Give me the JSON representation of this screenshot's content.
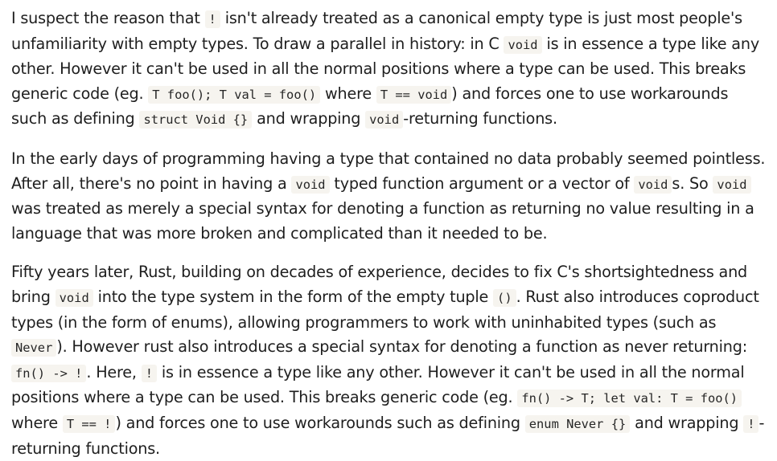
{
  "paragraphs": [
    {
      "segments": [
        {
          "t": "text",
          "v": "I suspect the reason that "
        },
        {
          "t": "code",
          "v": "!"
        },
        {
          "t": "text",
          "v": " isn't already treated as a canonical empty type is just most people's unfamiliarity with empty types. To draw a parallel in history: in C "
        },
        {
          "t": "code",
          "v": "void"
        },
        {
          "t": "text",
          "v": " is in essence a type like any other. However it can't be used in all the normal positions where a type can be used. This breaks generic code (eg. "
        },
        {
          "t": "code",
          "v": "T foo(); T val = foo()"
        },
        {
          "t": "text",
          "v": " where "
        },
        {
          "t": "code",
          "v": "T == void"
        },
        {
          "t": "text",
          "v": ") and forces one to use workarounds such as defining "
        },
        {
          "t": "code",
          "v": "struct Void {}"
        },
        {
          "t": "text",
          "v": " and wrapping "
        },
        {
          "t": "code",
          "v": "void"
        },
        {
          "t": "text",
          "v": "-returning functions."
        }
      ]
    },
    {
      "segments": [
        {
          "t": "text",
          "v": "In the early days of programming having a type that contained no data probably seemed pointless. After all, there's no point in having a "
        },
        {
          "t": "code",
          "v": "void"
        },
        {
          "t": "text",
          "v": " typed function argument or a vector of "
        },
        {
          "t": "code",
          "v": "void"
        },
        {
          "t": "text",
          "v": "s. So "
        },
        {
          "t": "code",
          "v": "void"
        },
        {
          "t": "text",
          "v": " was treated as merely a special syntax for denoting a function as returning no value resulting in a language that was more broken and complicated than it needed to be."
        }
      ]
    },
    {
      "segments": [
        {
          "t": "text",
          "v": "Fifty years later, Rust, building on decades of experience, decides to fix C's shortsightedness and bring "
        },
        {
          "t": "code",
          "v": "void"
        },
        {
          "t": "text",
          "v": " into the type system in the form of the empty tuple "
        },
        {
          "t": "code",
          "v": "()"
        },
        {
          "t": "text",
          "v": ". Rust also introduces coproduct types (in the form of enums), allowing programmers to work with uninhabited types (such as "
        },
        {
          "t": "code",
          "v": "Never"
        },
        {
          "t": "text",
          "v": "). However rust also introduces a special syntax for denoting a function as never returning: "
        },
        {
          "t": "code",
          "v": "fn() -> !"
        },
        {
          "t": "text",
          "v": ". Here, "
        },
        {
          "t": "code",
          "v": "!"
        },
        {
          "t": "text",
          "v": " is in essence a type like any other. However it can't be used in all the normal positions where a type can be used. This breaks generic code (eg. "
        },
        {
          "t": "code",
          "v": "fn() -> T; let val: T = foo()"
        },
        {
          "t": "text",
          "v": " where "
        },
        {
          "t": "code",
          "v": "T == !"
        },
        {
          "t": "text",
          "v": ") and forces one to use workarounds such as defining "
        },
        {
          "t": "code",
          "v": "enum Never {}"
        },
        {
          "t": "text",
          "v": " and wrapping "
        },
        {
          "t": "code",
          "v": "!"
        },
        {
          "t": "text",
          "v": "-returning functions."
        }
      ]
    }
  ]
}
